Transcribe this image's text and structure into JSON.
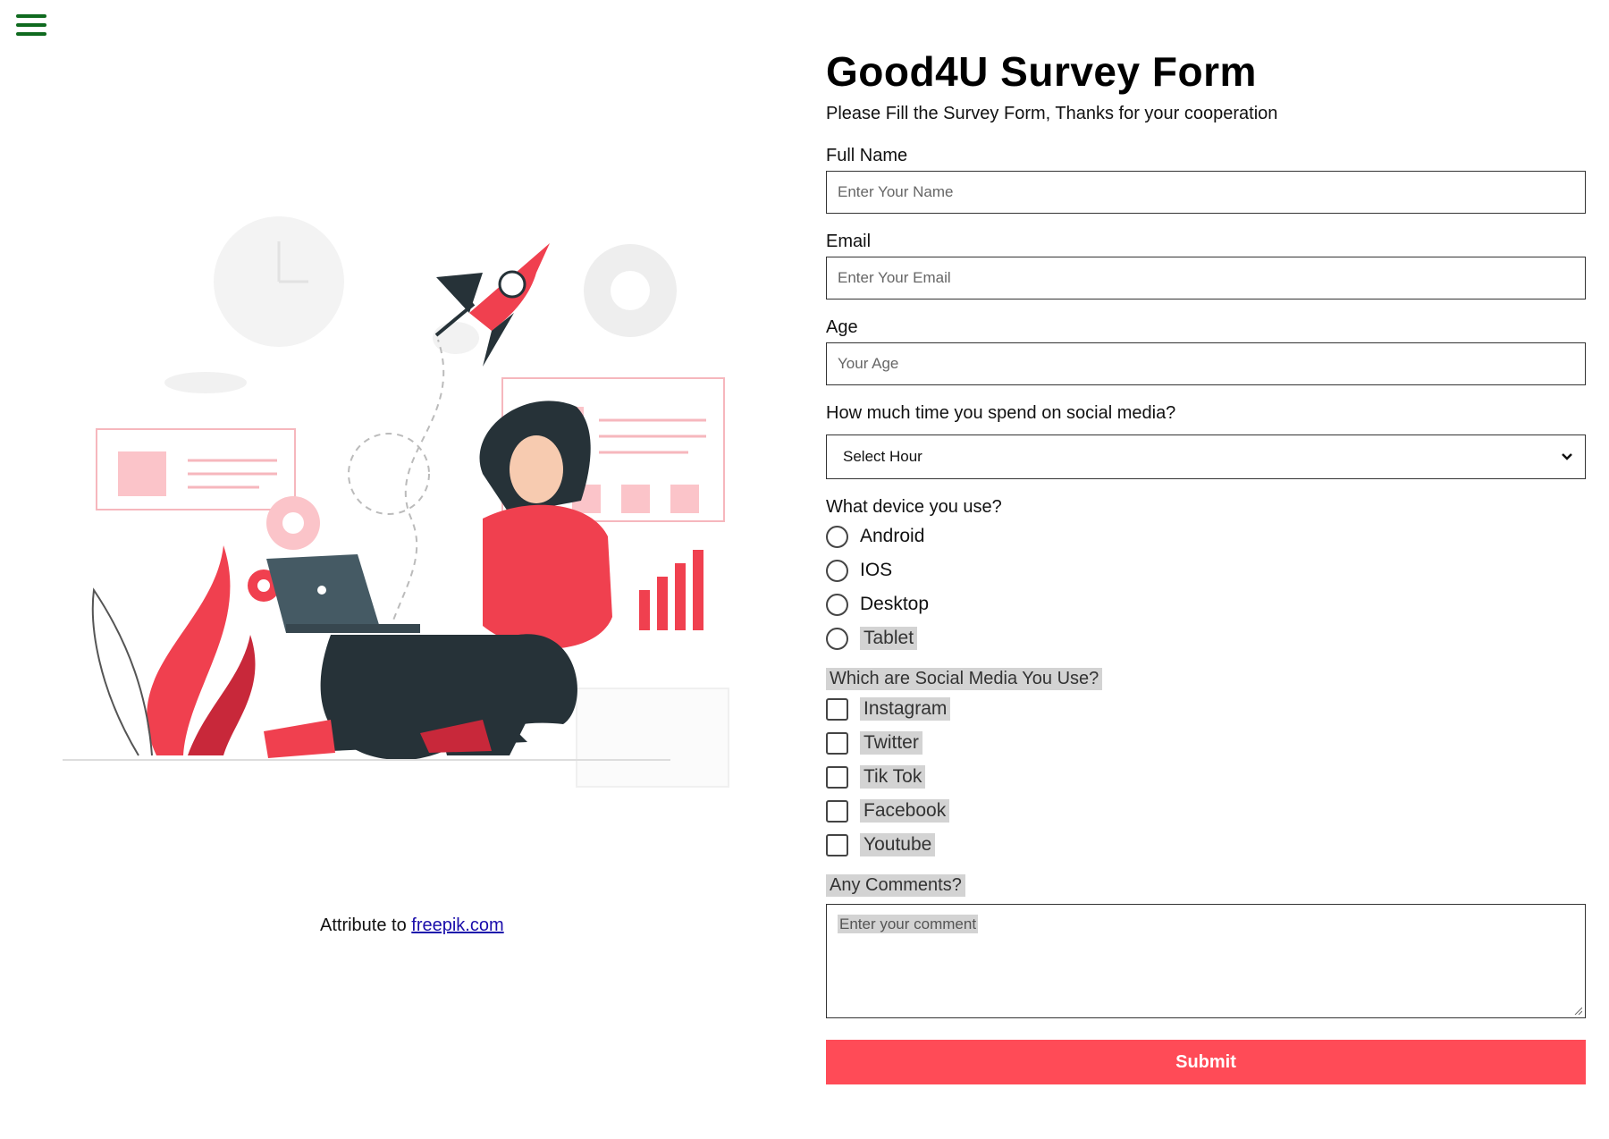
{
  "menu": {
    "icon": "hamburger-menu-icon"
  },
  "attribution": {
    "prefix": "Attribute to",
    "link_text": "freepik.com"
  },
  "form": {
    "title": "Good4U Survey Form",
    "subtitle": "Please Fill the Survey Form, Thanks for your cooperation",
    "full_name": {
      "label": "Full Name",
      "placeholder": "Enter Your Name"
    },
    "email": {
      "label": "Email",
      "placeholder": "Enter Your Email"
    },
    "age": {
      "label": "Age",
      "placeholder": "Your Age"
    },
    "social_time": {
      "label": "How much time you spend on social media?",
      "selected": "Select Hour"
    },
    "device": {
      "label": "What device you use?",
      "options": [
        "Android",
        "IOS",
        "Desktop",
        "Tablet"
      ]
    },
    "social_media": {
      "label": "Which are Social Media You Use?",
      "options": [
        "Instagram",
        "Twitter",
        "Tik Tok",
        "Facebook",
        "Youtube"
      ]
    },
    "comments": {
      "label": "Any Comments?",
      "placeholder": "Enter your comment"
    },
    "submit_label": "Submit"
  },
  "colors": {
    "accent": "#ff4b57",
    "menu": "#0f6a1f",
    "highlight": "#d3d3d3"
  }
}
